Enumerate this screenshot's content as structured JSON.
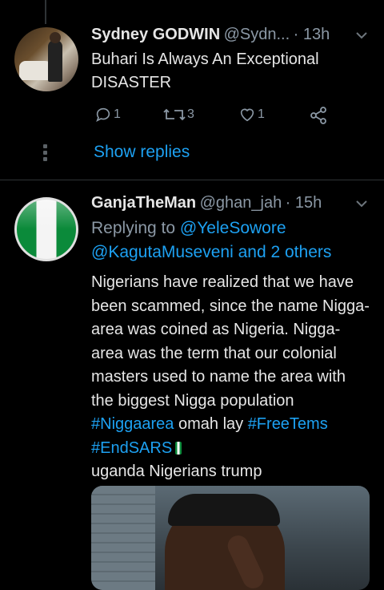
{
  "tweet1": {
    "name": "Sydney GODWIN",
    "handle": "@Sydn...",
    "time": "· 13h",
    "text_line1": "Buhari Is Always An Exceptional",
    "text_line2": "DISASTER",
    "replies": "1",
    "retweets": "3",
    "likes": "1",
    "show_replies": "Show replies"
  },
  "tweet2": {
    "name": "GanjaTheMan",
    "handle": "@ghan_jah",
    "time": "· 15h",
    "replying_to": "Replying to",
    "reply_user": "@YeleSowore",
    "reply_user2": "@KagutaMuseveni",
    "reply_others": "and 2 others",
    "text_a": "Nigerians have realized that we have been scammed, since the name Nigga-area was coined as Nigeria. Nigga-area was the term that our colonial masters used to name the area with the biggest Nigga population ",
    "tag1": "#Niggaarea",
    "text_b": " omah lay ",
    "tag2": "#FreeTems",
    "tag3": "#EndSARS",
    "text_c": "uganda Nigerians trump"
  },
  "colors": {
    "accent": "#1da1f2",
    "background": "#000000",
    "muted": "#8b98a5"
  }
}
